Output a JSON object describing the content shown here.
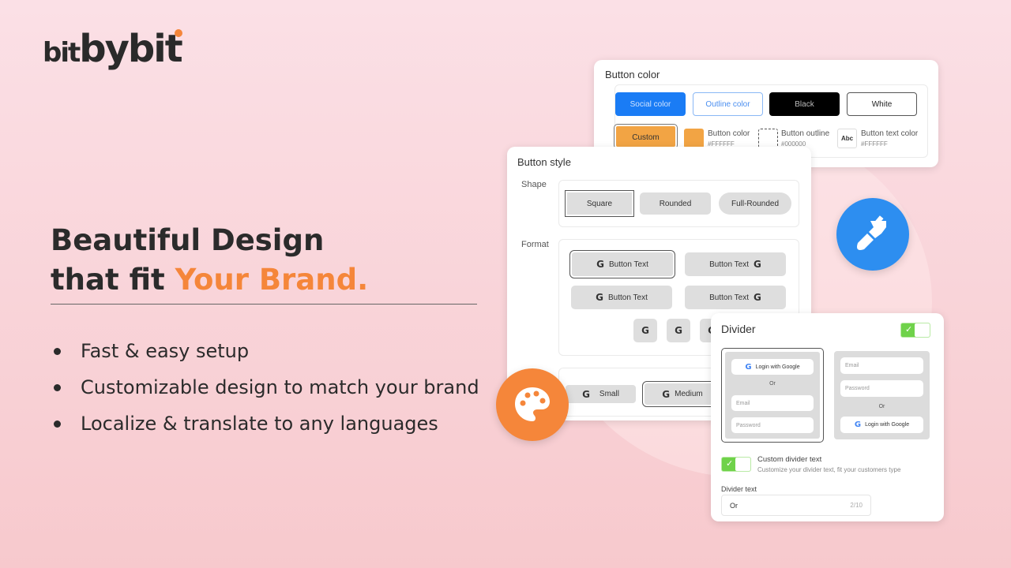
{
  "logo": {
    "text": "bitbybit",
    "part1": "bit",
    "part2": "by",
    "part3": "bit"
  },
  "hero": {
    "line1": "Beautiful Design",
    "line2_prefix": "that fit ",
    "line2_accent": "Your Brand."
  },
  "features": [
    "Fast & easy setup",
    "Customizable design to match your brand",
    "Localize & translate to any languages"
  ],
  "colors": {
    "accent": "#f5863a",
    "social": "#1a7cf5",
    "custom": "#f2a444",
    "toggle": "#6fd24a",
    "paint_circle": "#2d8ef0"
  },
  "button_color": {
    "title": "Button color",
    "options": [
      "Social color",
      "Outline color",
      "Black",
      "White",
      "Custom"
    ],
    "swatches": [
      {
        "label": "Button color",
        "value": "#FFFFFF"
      },
      {
        "label": "Button outline",
        "value": "#000000"
      },
      {
        "label": "Button text color",
        "value": "#FFFFFF",
        "icon_text": "Abc"
      }
    ]
  },
  "button_style": {
    "title": "Button style",
    "shape_label": "Shape",
    "shapes": [
      "Square",
      "Rounded",
      "Full-Rounded"
    ],
    "format_label": "Format",
    "button_text": "Button Text",
    "google_glyph": "G",
    "sizes": [
      "Small",
      "Medium"
    ]
  },
  "divider": {
    "title": "Divider",
    "login_google": "Login with Google",
    "or": "Or",
    "email": "Email",
    "password": "Password",
    "custom_title": "Custom divider text",
    "custom_desc": "Customize your divider text, fit your customers type",
    "text_label": "Divider text",
    "text_value": "Or",
    "counter": "2/10"
  },
  "icons": {
    "paint": "paint-brush-icon",
    "palette": "palette-icon",
    "check": "check-icon"
  }
}
